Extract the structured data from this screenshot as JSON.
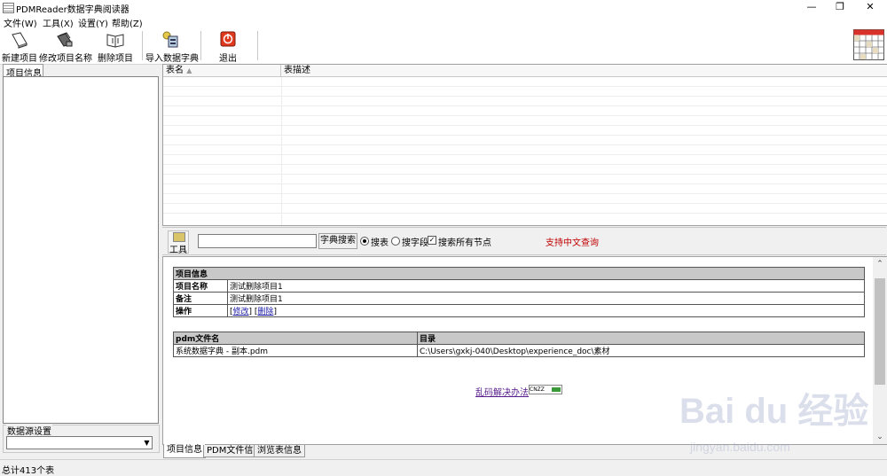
{
  "window": {
    "title": "PDMReader数据字典阅读器"
  },
  "menu": [
    "文件(W)",
    "工具(X)",
    "设置(Y)",
    "帮助(Z)"
  ],
  "toolbar": {
    "new_project": "新建项目",
    "rename_project": "修改项目名称",
    "delete_project": "删除项目",
    "import_dict": "导入数据字典",
    "exit": "退出"
  },
  "left": {
    "tab": "项目信息",
    "datasource_label": "数据源设置",
    "datasource_value": ""
  },
  "table_list": {
    "columns": [
      "表名",
      "表描述"
    ]
  },
  "search": {
    "tool_label": "工具",
    "input_value": "",
    "button": "字典搜索",
    "opt_table": "搜表",
    "opt_field": "搜字段",
    "opt_all_nodes": "搜索所有节点",
    "hint": "支持中文查询"
  },
  "project_info": {
    "header": "项目信息",
    "name_key": "项目名称",
    "name_value": "测试删除项目1",
    "remark_key": "备注",
    "remark_value": "测试删除项目1",
    "op_key": "操作",
    "op_edit": "修改",
    "op_delete": "删除"
  },
  "pdm_files": {
    "col_file": "pdm文件名",
    "col_dir": "目录",
    "file": "系统数据字典 - 副本.pdm",
    "dir": "C:\\Users\\gxkj-040\\Desktop\\experience_doc\\素材"
  },
  "garble_link": "乱码解决办法",
  "garble_icon_text": "CNZZ",
  "bottom_tabs": [
    "项目信息",
    "PDM文件信息",
    "浏览表信息"
  ],
  "status": "总计413个表",
  "watermark": {
    "line1": "Bai du 经验",
    "line2": "jingyan.baidu.com"
  },
  "colors": {
    "hint": "#c00000",
    "header_bg": "#c8c8c8",
    "link": "#1a1aa6"
  }
}
